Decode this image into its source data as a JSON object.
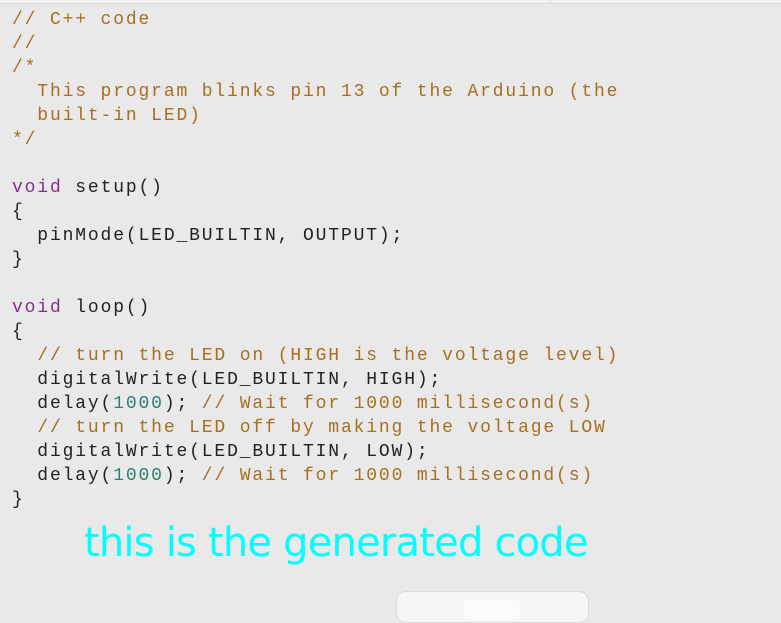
{
  "editor": {
    "language_comment": "// C++ code",
    "lines": [
      [
        {
          "t": "// C++ code",
          "c": "cmt"
        }
      ],
      [
        {
          "t": "//",
          "c": "cmt"
        }
      ],
      [
        {
          "t": "/*",
          "c": "cmt"
        }
      ],
      [
        {
          "t": "  This program blinks pin 13 of the Arduino (the",
          "c": "cmt"
        }
      ],
      [
        {
          "t": "  built-in LED)",
          "c": "cmt"
        }
      ],
      [
        {
          "t": "*/",
          "c": "cmt"
        }
      ],
      [],
      [
        {
          "t": "void",
          "c": "kw"
        },
        {
          "t": " setup()",
          "c": "plain"
        }
      ],
      [
        {
          "t": "{",
          "c": "plain"
        }
      ],
      [
        {
          "t": "  pinMode(LED_BUILTIN, OUTPUT);",
          "c": "plain"
        }
      ],
      [
        {
          "t": "}",
          "c": "plain"
        }
      ],
      [],
      [
        {
          "t": "void",
          "c": "kw"
        },
        {
          "t": " loop()",
          "c": "plain"
        }
      ],
      [
        {
          "t": "{",
          "c": "plain"
        }
      ],
      [
        {
          "t": "  ",
          "c": "plain"
        },
        {
          "t": "// turn the LED on (HIGH is the voltage level)",
          "c": "cmt"
        }
      ],
      [
        {
          "t": "  digitalWrite(LED_BUILTIN, HIGH);",
          "c": "plain"
        }
      ],
      [
        {
          "t": "  delay(",
          "c": "plain"
        },
        {
          "t": "1000",
          "c": "num"
        },
        {
          "t": "); ",
          "c": "plain"
        },
        {
          "t": "// Wait for 1000 millisecond(s)",
          "c": "cmt"
        }
      ],
      [
        {
          "t": "  ",
          "c": "plain"
        },
        {
          "t": "// turn the LED off by making the voltage LOW",
          "c": "cmt"
        }
      ],
      [
        {
          "t": "  digitalWrite(LED_BUILTIN, LOW);",
          "c": "plain"
        }
      ],
      [
        {
          "t": "  delay(",
          "c": "plain"
        },
        {
          "t": "1000",
          "c": "num"
        },
        {
          "t": "); ",
          "c": "plain"
        },
        {
          "t": "// Wait for 1000 millisecond(s)",
          "c": "cmt"
        }
      ],
      [
        {
          "t": "}",
          "c": "plain"
        }
      ]
    ]
  },
  "caption": "this is the generated code",
  "colors": {
    "comment": "#a86f1e",
    "keyword": "#8a2d91",
    "number": "#2e7d76",
    "caption": "#00ffff",
    "background": "#e9e9e9"
  }
}
